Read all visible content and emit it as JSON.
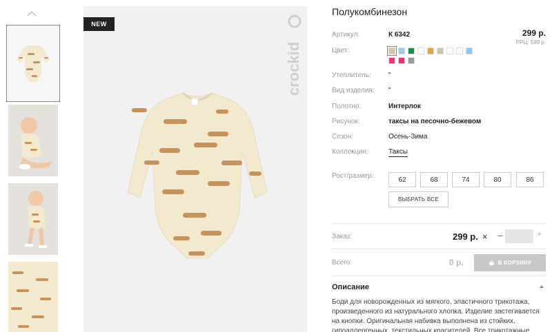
{
  "badge_new": "NEW",
  "brand": "crockid",
  "product": {
    "title": "Полукомбинезон",
    "price": "299 р.",
    "rrp": "РРЦ: 599 р."
  },
  "specs": {
    "article_label": "Артикул:",
    "article_value": "К 6342",
    "color_label": "Цвет:",
    "insulation_label": "Утеплитель:",
    "insulation_value": "\"",
    "type_label": "Вид изделия:",
    "type_value": "\"",
    "fabric_label": "Полотно:",
    "fabric_value": "Интерлок",
    "pattern_label": "Рисунок:",
    "pattern_value": "таксы на песочно-бежевом",
    "season_label": "Сезон:",
    "season_value": "Осень-Зима",
    "collection_label": "Коллекция:",
    "collection_value": "Таксы"
  },
  "swatch_colors": [
    "#d8c8a4",
    "#9fcdf0",
    "#1e8a4e",
    "#ffffff",
    "#e8a040",
    "#cfc4a8",
    "#ffffff",
    "#ffffff",
    "#8ecaf5",
    "#e8347c",
    "#e8347c",
    "#9a9a9a"
  ],
  "size": {
    "label": "Рост/размер:",
    "options": [
      "62",
      "68",
      "74",
      "80",
      "86"
    ],
    "select_all": "ВЫБРАТЬ ВСЕ"
  },
  "order": {
    "label": "Заказ:",
    "price": "299 р.",
    "multiply": "×",
    "minus": "–",
    "plus": "+",
    "qty": ""
  },
  "total": {
    "label": "Всего:",
    "value": "0 р.",
    "cart_button": "В КОРЗИНУ"
  },
  "description": {
    "title": "Описание",
    "text": "Боди для новорожденных из мягкого, эластичного трикотажа, произведенного из натурального хлопка. Изделие застегивается на кнопки. Оригинальная набивка выполнена из стойких, гипоаллергенных, текстильных красителей. Все трикотажные"
  },
  "colors": {
    "garment": "#f3e9cf",
    "dog": "#c8925a",
    "badge_bg": "#222222",
    "button_disabled": "#c8c8c8"
  }
}
